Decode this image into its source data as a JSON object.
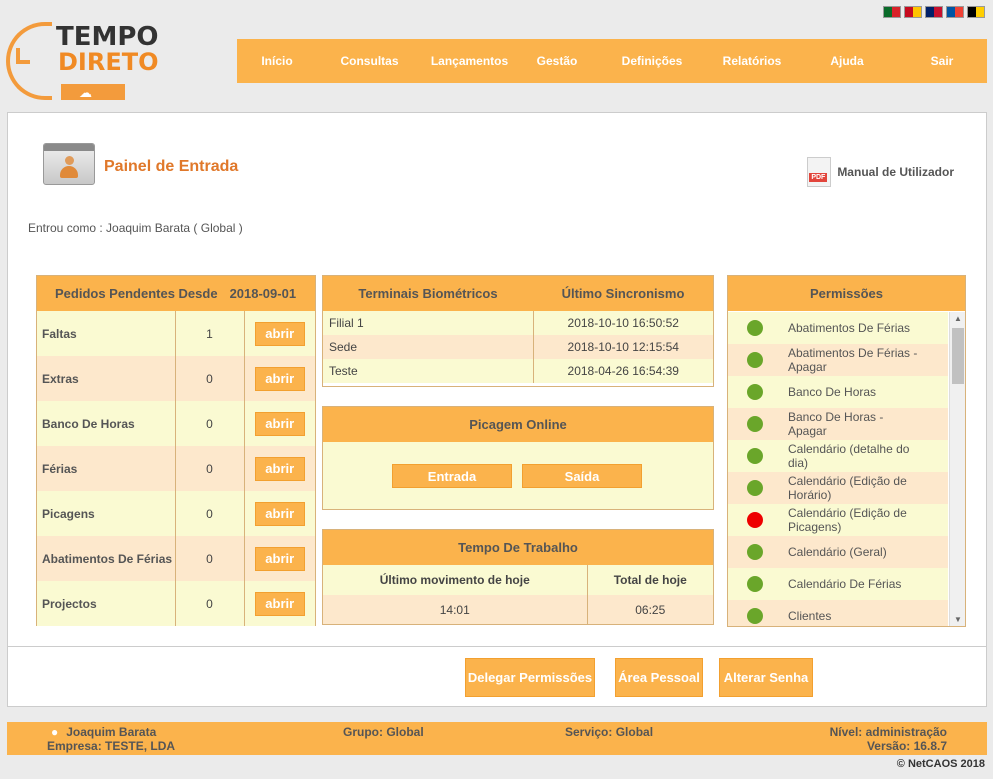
{
  "logo": {
    "line1": "TEMPO",
    "line2": "DIRETO"
  },
  "flags": [
    {
      "name": "flag-portugal",
      "c1": "#0a6b2a",
      "c2": "#d8232a"
    },
    {
      "name": "flag-spain",
      "c1": "#c60b1e",
      "c2": "#ffc400"
    },
    {
      "name": "flag-uk",
      "c1": "#012169",
      "c2": "#c8102e"
    },
    {
      "name": "flag-france",
      "c1": "#0055a4",
      "c2": "#ef4135"
    },
    {
      "name": "flag-germany",
      "c1": "#000000",
      "c2": "#ffce00"
    }
  ],
  "nav": [
    "Início",
    "Consultas",
    "Lançamentos",
    "Gestão",
    "Definições",
    "Relatórios",
    "Ajuda",
    "Sair"
  ],
  "page": {
    "title": "Painel de Entrada",
    "manual": "Manual de Utilizador",
    "pdf_label": "PDF",
    "logged_in": "Entrou como : Joaquim Barata  ( Global )"
  },
  "pending": {
    "title": "Pedidos Pendentes Desde",
    "since": "2018-09-01",
    "button_label": "abrir",
    "rows": [
      {
        "label": "Faltas",
        "count": "1"
      },
      {
        "label": "Extras",
        "count": "0"
      },
      {
        "label": "Banco De Horas",
        "count": "0"
      },
      {
        "label": "Férias",
        "count": "0"
      },
      {
        "label": "Picagens",
        "count": "0"
      },
      {
        "label": "Abatimentos De Férias",
        "count": "0"
      },
      {
        "label": "Projectos",
        "count": "0"
      }
    ]
  },
  "terminals": {
    "col1": "Terminais Biométricos",
    "col2": "Último Sincronismo",
    "rows": [
      {
        "name": "Filial 1",
        "sync": "2018-10-10 16:50:52"
      },
      {
        "name": "Sede",
        "sync": "2018-10-10 12:15:54"
      },
      {
        "name": "Teste",
        "sync": "2018-04-26 16:54:39"
      }
    ]
  },
  "punch": {
    "title": "Picagem Online",
    "in_label": "Entrada",
    "out_label": "Saída"
  },
  "worktime": {
    "title": "Tempo De Trabalho",
    "col1": "Último movimento de hoje",
    "col2": "Total de hoje",
    "last": "14:01",
    "total": "06:25"
  },
  "permissions": {
    "title": "Permissões",
    "items": [
      {
        "label": "Abatimentos De Férias",
        "status": "green"
      },
      {
        "label": "Abatimentos De Férias - Apagar",
        "status": "green"
      },
      {
        "label": "Banco De Horas",
        "status": "green"
      },
      {
        "label": "Banco De Horas - Apagar",
        "status": "green"
      },
      {
        "label": "Calendário (detalhe do dia)",
        "status": "green"
      },
      {
        "label": "Calendário (Edição de Horário)",
        "status": "green"
      },
      {
        "label": "Calendário (Edição de Picagens)",
        "status": "red"
      },
      {
        "label": "Calendário (Geral)",
        "status": "green"
      },
      {
        "label": "Calendário De Férias",
        "status": "green"
      },
      {
        "label": "Clientes",
        "status": "green"
      }
    ]
  },
  "actions": {
    "delegate": "Delegar Permissões",
    "personal": "Área Pessoal",
    "password": "Alterar Senha"
  },
  "footer": {
    "user": "Joaquim Barata",
    "company": "Empresa: TESTE, LDA",
    "group": "Grupo: Global",
    "service": "Serviço: Global",
    "level": "Nível: administração",
    "version": "Versão:  16.8.7",
    "copyright": "© NetCAOS 2018"
  }
}
